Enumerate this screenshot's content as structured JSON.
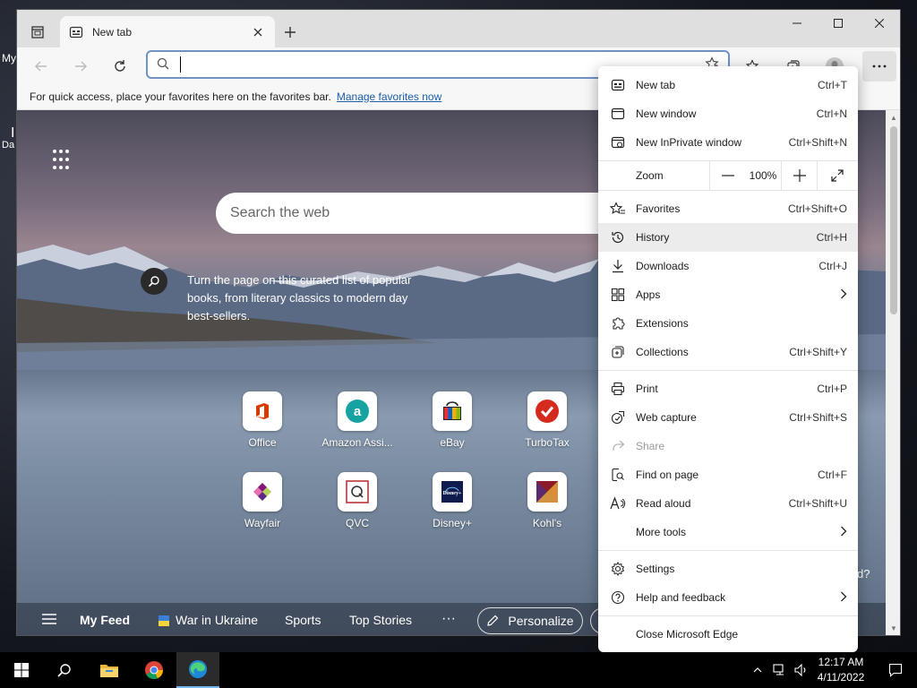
{
  "desktop": {
    "label_a": "My",
    "label_b": "I",
    "label_c": "Da",
    "partial_text": "d?"
  },
  "browser": {
    "tab": {
      "title": "New tab"
    },
    "address": {
      "placeholder": "",
      "value": ""
    },
    "favbar": {
      "text": "For quick access, place your favorites here on the favorites bar.",
      "link": "Manage favorites now"
    }
  },
  "newtab": {
    "search_placeholder": "Search the web",
    "caption": "Turn the page on this curated list of popular books, from literary classics to modern day best-sellers.",
    "tiles": [
      {
        "label": "Office",
        "icon": "office-icon",
        "color": "#d83b01"
      },
      {
        "label": "Amazon Assi...",
        "icon": "amazon-assistant-icon",
        "color": "#17a2a2"
      },
      {
        "label": "eBay",
        "icon": "ebay-icon",
        "color": "#1a1a1a"
      },
      {
        "label": "TurboTax",
        "icon": "turbotax-icon",
        "color": "#d52b1e"
      },
      {
        "label": "Wayfair",
        "icon": "wayfair-icon",
        "color": "#7f187f"
      },
      {
        "label": "QVC",
        "icon": "qvc-icon",
        "color": "#b3282d"
      },
      {
        "label": "Disney+",
        "icon": "disney-plus-icon",
        "color": "#0f1c4d"
      },
      {
        "label": "Kohl's",
        "icon": "kohls-icon",
        "color": "#8b1a2b"
      }
    ],
    "feed": {
      "my_feed": "My Feed",
      "war": "War in Ukraine",
      "sports": "Sports",
      "top": "Top Stories",
      "more": "···",
      "personalize": "Personalize"
    }
  },
  "menu": {
    "items": [
      {
        "label": "New tab",
        "shortcut": "Ctrl+T"
      },
      {
        "label": "New window",
        "shortcut": "Ctrl+N"
      },
      {
        "label": "New InPrivate window",
        "shortcut": "Ctrl+Shift+N"
      },
      {
        "label": "Favorites",
        "shortcut": "Ctrl+Shift+O"
      },
      {
        "label": "History",
        "shortcut": "Ctrl+H"
      },
      {
        "label": "Downloads",
        "shortcut": "Ctrl+J"
      },
      {
        "label": "Apps",
        "shortcut": ""
      },
      {
        "label": "Extensions",
        "shortcut": ""
      },
      {
        "label": "Collections",
        "shortcut": "Ctrl+Shift+Y"
      },
      {
        "label": "Print",
        "shortcut": "Ctrl+P"
      },
      {
        "label": "Web capture",
        "shortcut": "Ctrl+Shift+S"
      },
      {
        "label": "Share",
        "shortcut": ""
      },
      {
        "label": "Find on page",
        "shortcut": "Ctrl+F"
      },
      {
        "label": "Read aloud",
        "shortcut": "Ctrl+Shift+U"
      },
      {
        "label": "More tools",
        "shortcut": ""
      },
      {
        "label": "Settings",
        "shortcut": ""
      },
      {
        "label": "Help and feedback",
        "shortcut": ""
      },
      {
        "label": "Close Microsoft Edge",
        "shortcut": ""
      }
    ],
    "zoom": {
      "label": "Zoom",
      "minus": "—",
      "value": "100%",
      "plus": "+"
    }
  },
  "taskbar": {
    "time": "12:17 AM",
    "date": "4/11/2022"
  }
}
